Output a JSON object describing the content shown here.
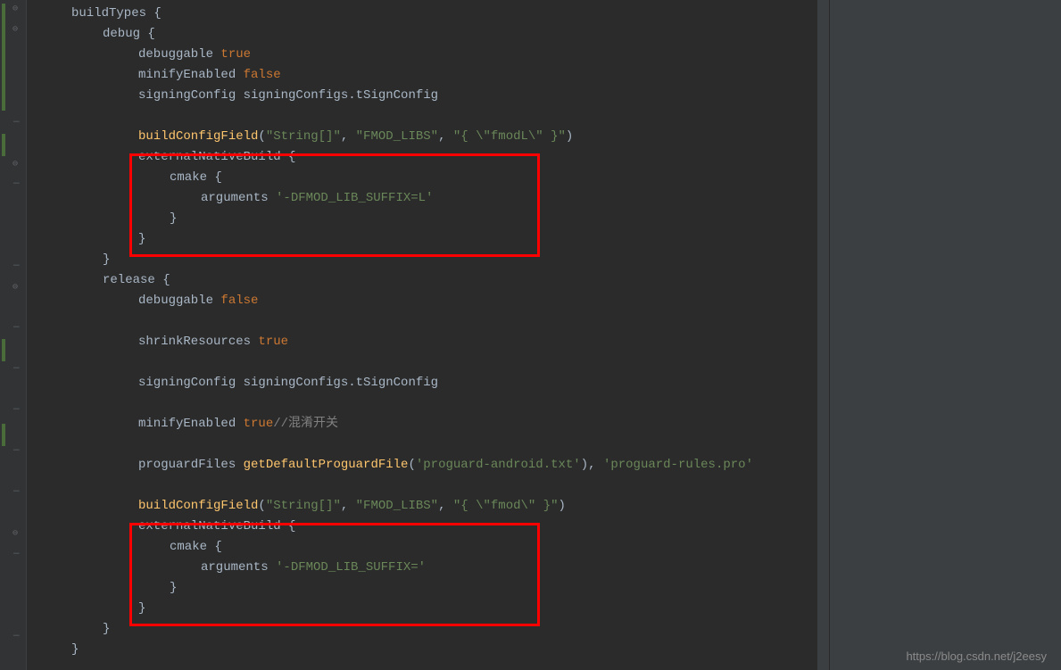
{
  "code": {
    "l1": {
      "ident": "buildTypes",
      "brace": " {"
    },
    "l2": {
      "ident": "debug",
      "brace": " {"
    },
    "l3": {
      "ident": "debuggable ",
      "kw": "true"
    },
    "l4": {
      "ident": "minifyEnabled ",
      "kw": "false"
    },
    "l5": {
      "ident": "signingConfig signingConfigs.tSignConfig"
    },
    "l6": {
      "method": "buildConfigField",
      "paren": "(",
      "s1": "\"String[]\"",
      "c1": ", ",
      "s2": "\"FMOD_LIBS\"",
      "c2": ", ",
      "s3": "\"{ \\\"fmodL\\\" }\"",
      "close": ")"
    },
    "l7": {
      "ident": "externalNativeBuild",
      "brace": " {"
    },
    "l8": {
      "ident": "cmake",
      "brace": " {"
    },
    "l9": {
      "ident": "arguments ",
      "s1": "'-DFMOD_LIB_SUFFIX=L'"
    },
    "l10": {
      "brace": "}"
    },
    "l11": {
      "brace": "}"
    },
    "l12": {
      "brace": "}"
    },
    "l13": {
      "ident": "release",
      "brace": " {"
    },
    "l14": {
      "ident": "debuggable ",
      "kw": "false"
    },
    "l15": {
      "ident": "shrinkResources ",
      "kw": "true"
    },
    "l16": {
      "ident": "signingConfig signingConfigs.tSignConfig"
    },
    "l17": {
      "ident": "minifyEnabled ",
      "kw": "true",
      "comment": "//混淆开关"
    },
    "l18": {
      "ident": "proguardFiles ",
      "method": "getDefaultProguardFile",
      "paren": "(",
      "s1": "'proguard-android.txt'",
      "close": "), ",
      "s2": "'proguard-rules.pro'"
    },
    "l19": {
      "method": "buildConfigField",
      "paren": "(",
      "s1": "\"String[]\"",
      "c1": ", ",
      "s2": "\"FMOD_LIBS\"",
      "c2": ", ",
      "s3": "\"{ \\\"fmod\\\" }\"",
      "close": ")"
    },
    "l20": {
      "ident": "externalNativeBuild",
      "brace": " {"
    },
    "l21": {
      "ident": "cmake",
      "brace": " {"
    },
    "l22": {
      "ident": "arguments ",
      "s1": "'-DFMOD_LIB_SUFFIX='"
    },
    "l23": {
      "brace": "}"
    },
    "l24": {
      "brace": "}"
    },
    "l25": {
      "brace": "}"
    },
    "l26": {
      "brace": "}"
    }
  },
  "watermark": "https://blog.csdn.net/j2eesy",
  "gutter": {
    "dashes": [
      "—",
      "—",
      "—",
      "—",
      "—",
      "—",
      "—",
      "—",
      "—",
      "—"
    ],
    "folds": [
      "⊖",
      "⊖",
      "⊖",
      "⊖",
      "⊖",
      "⊖"
    ]
  }
}
